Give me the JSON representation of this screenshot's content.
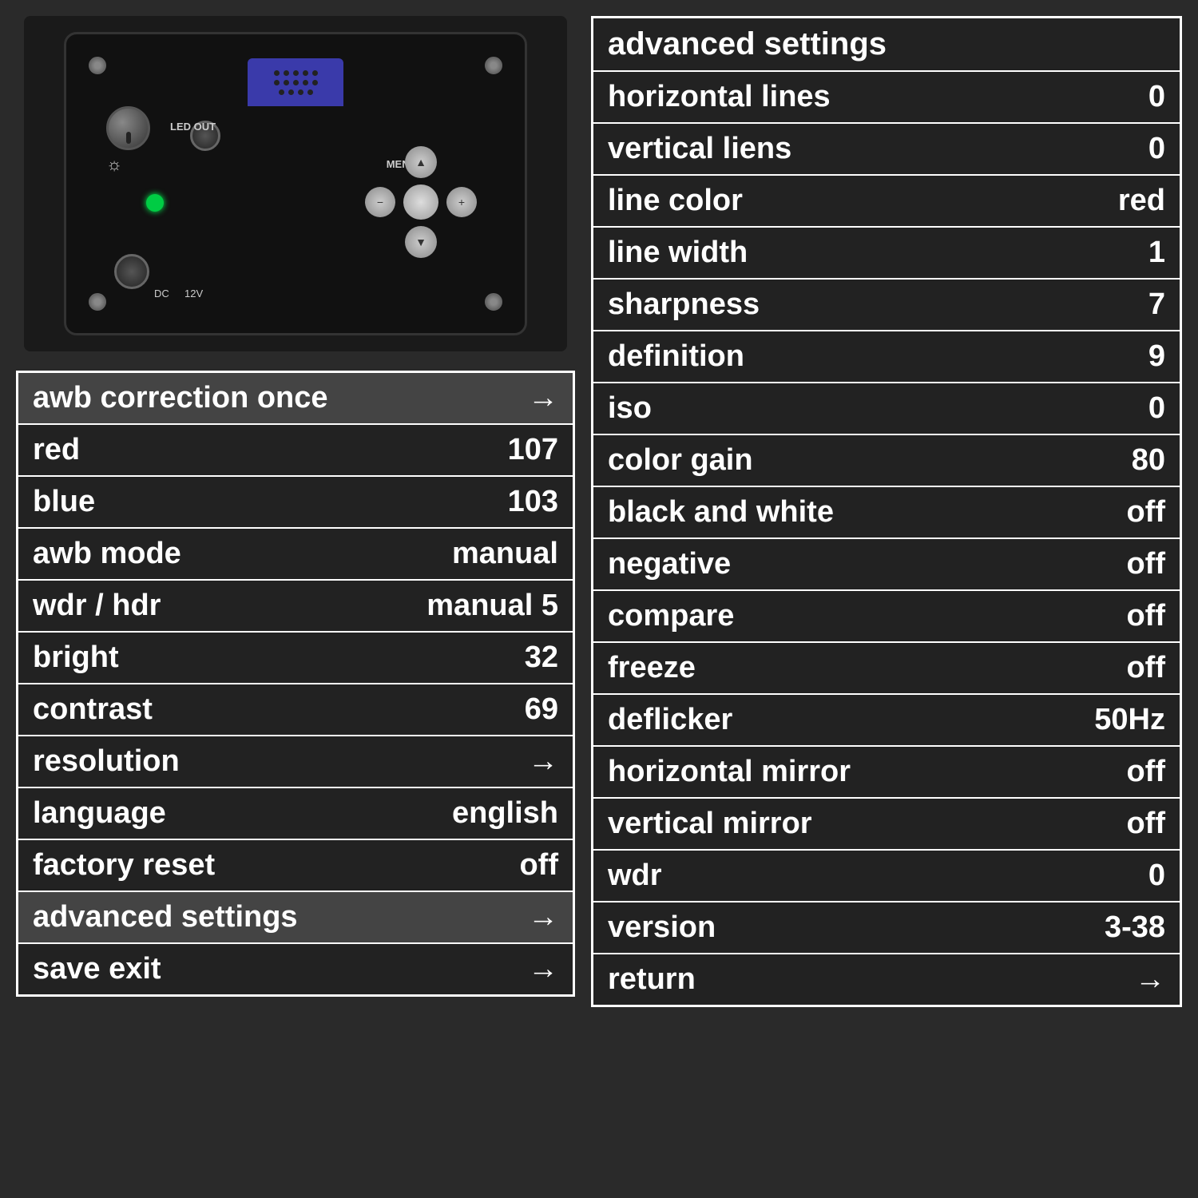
{
  "camera": {
    "led_label": "LED OUT",
    "menu_label": "MENU",
    "dc_label": "DC",
    "v12_label": "12V"
  },
  "left_menu": {
    "title": "awb correction once",
    "items": [
      {
        "label": "awb correction once",
        "value": "→",
        "highlighted": true
      },
      {
        "label": "red",
        "value": "107"
      },
      {
        "label": "blue",
        "value": "103"
      },
      {
        "label": "awb mode",
        "value": "manual"
      },
      {
        "label": "wdr / hdr",
        "value": "manual 5"
      },
      {
        "label": "bright",
        "value": "32"
      },
      {
        "label": "contrast",
        "value": "69"
      },
      {
        "label": "resolution",
        "value": "→"
      },
      {
        "label": "language",
        "value": "english"
      },
      {
        "label": "factory reset",
        "value": "off"
      },
      {
        "label": "advanced settings",
        "value": "→",
        "highlighted": true
      },
      {
        "label": "save exit",
        "value": "→"
      }
    ]
  },
  "right_menu": {
    "title": "advanced settings",
    "items": [
      {
        "label": "horizontal lines",
        "value": "0"
      },
      {
        "label": "vertical liens",
        "value": "0"
      },
      {
        "label": "line color",
        "value": "red"
      },
      {
        "label": "line width",
        "value": "1"
      },
      {
        "label": "sharpness",
        "value": "7"
      },
      {
        "label": "definition",
        "value": "9"
      },
      {
        "label": "iso",
        "value": "0"
      },
      {
        "label": "color gain",
        "value": "80"
      },
      {
        "label": "black and white",
        "value": "off"
      },
      {
        "label": "negative",
        "value": "off"
      },
      {
        "label": "compare",
        "value": "off"
      },
      {
        "label": "freeze",
        "value": "off"
      },
      {
        "label": "deflicker",
        "value": "50Hz"
      },
      {
        "label": "horizontal mirror",
        "value": "off"
      },
      {
        "label": "vertical mirror",
        "value": "off"
      },
      {
        "label": "wdr",
        "value": "0"
      },
      {
        "label": "version",
        "value": "3-38"
      },
      {
        "label": "return",
        "value": "→"
      }
    ]
  }
}
